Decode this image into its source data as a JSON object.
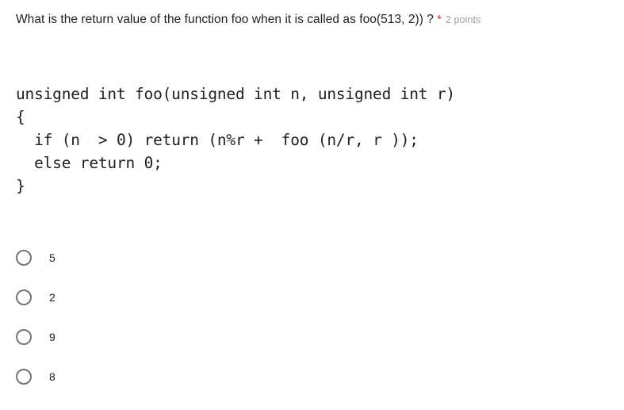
{
  "question": {
    "title": "What is the return value of the function foo when it is called as foo(513, 2)) ?",
    "required_marker": "*",
    "points": "2 points"
  },
  "code": {
    "text": "unsigned int foo(unsigned int n, unsigned int r)\n{\n  if (n  > 0) return (n%r +  foo (n/r, r ));\n  else return 0;\n}"
  },
  "options": [
    {
      "label": "5",
      "selected": false
    },
    {
      "label": "2",
      "selected": false
    },
    {
      "label": "9",
      "selected": false
    },
    {
      "label": "8",
      "selected": false
    }
  ],
  "colors": {
    "text": "#202124",
    "required": "#d93025",
    "points": "#9aa0a6",
    "radio_border": "#70757a",
    "background": "#ffffff"
  }
}
